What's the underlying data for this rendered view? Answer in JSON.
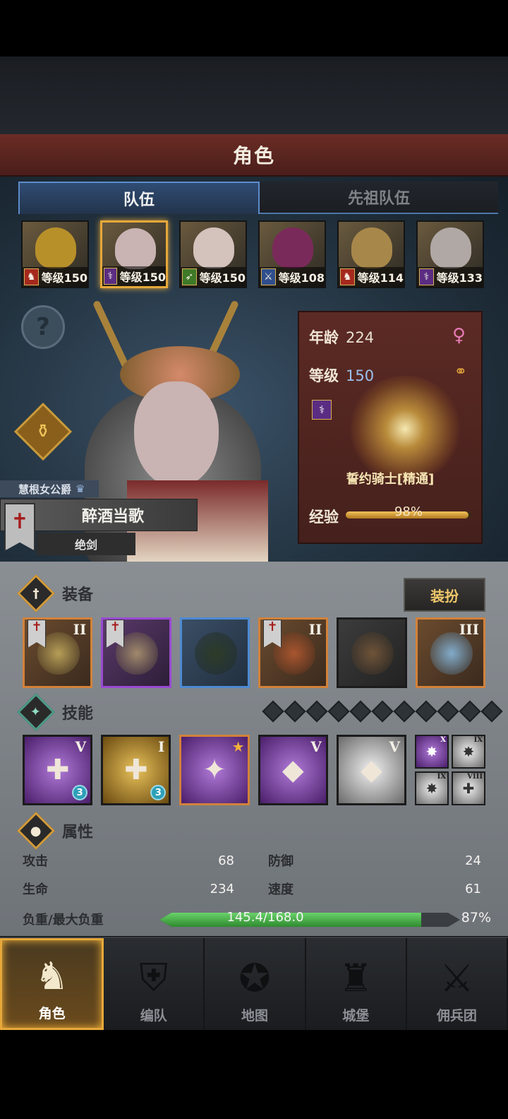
{
  "header": {
    "title": "角色"
  },
  "tabs": [
    {
      "label": "队伍",
      "active": true
    },
    {
      "label": "先祖队伍",
      "active": false
    }
  ],
  "party": [
    {
      "class_icon": "horse-icon",
      "class_color": "red",
      "level_text": "等级150",
      "selected": false,
      "face_color": "#b8902a"
    },
    {
      "class_icon": "staff-icon",
      "class_color": "purple",
      "level_text": "等级150",
      "selected": true,
      "face_color": "#c9b3b3"
    },
    {
      "class_icon": "bow-icon",
      "class_color": "green",
      "level_text": "等级150",
      "selected": false,
      "face_color": "#d4c2bc"
    },
    {
      "class_icon": "sword-icon",
      "class_color": "blue",
      "level_text": "等级108",
      "selected": false,
      "face_color": "#7a2a5a"
    },
    {
      "class_icon": "horse-icon",
      "class_color": "red",
      "level_text": "等级114",
      "selected": false,
      "face_color": "#a8884a"
    },
    {
      "class_icon": "staff-icon",
      "class_color": "purple",
      "level_text": "等级133",
      "selected": false,
      "face_color": "#b0a8a4"
    }
  ],
  "hero": {
    "title": "慧根女公爵",
    "name": "醉酒当歌",
    "subtitle": "绝剑"
  },
  "info": {
    "age_label": "年龄",
    "age_value": "224",
    "level_label": "等级",
    "level_value": "150",
    "class_name": "誓约骑士[精通]",
    "exp_label": "经验",
    "exp_text": "98%",
    "exp_fraction": 0.98,
    "gender_icon": "female-icon",
    "ring_icon": "ring-icon"
  },
  "equipment": {
    "title": "装备",
    "dress_button": "装扮",
    "slots": [
      {
        "name": "sword",
        "border": "orange",
        "tier": "II",
        "flag": true,
        "art": "#c8b060"
      },
      {
        "name": "shield",
        "border": "purple",
        "tier": "",
        "flag": true,
        "art": "#b09a70"
      },
      {
        "name": "hood",
        "border": "blue",
        "tier": "",
        "flag": false,
        "art": "#2d3a20"
      },
      {
        "name": "armor",
        "border": "orange",
        "tier": "II",
        "flag": true,
        "art": "#b85a30"
      },
      {
        "name": "boots",
        "border": "gray",
        "tier": "",
        "flag": false,
        "art": "#7a5a3a"
      },
      {
        "name": "amulet",
        "border": "orange",
        "tier": "III",
        "flag": false,
        "art": "#8ac0e8"
      }
    ]
  },
  "skills": {
    "title": "技能",
    "pip_count": 11,
    "items": [
      {
        "style": "purple",
        "rank": "V",
        "badge": "3",
        "glyph": "✚"
      },
      {
        "style": "gold",
        "rank": "I",
        "badge": "3",
        "glyph": "✚"
      },
      {
        "style": "orange-border",
        "rank": "",
        "badge": "",
        "star": true,
        "glyph": "✦"
      },
      {
        "style": "purple",
        "rank": "V",
        "badge": "",
        "glyph": "◆"
      },
      {
        "style": "silver",
        "rank": "V",
        "badge": "",
        "glyph": "◆"
      }
    ],
    "mini": [
      {
        "style": "purple",
        "rank": "X",
        "glyph": "✸"
      },
      {
        "style": "silver",
        "rank": "IX",
        "glyph": "✸"
      },
      {
        "style": "silver",
        "rank": "IX",
        "glyph": "✸"
      },
      {
        "style": "silver",
        "rank": "VIII",
        "glyph": "✚"
      }
    ]
  },
  "attributes": {
    "title": "属性",
    "attack_label": "攻击",
    "attack_value": "68",
    "defense_label": "防御",
    "defense_value": "24",
    "hp_label": "生命",
    "hp_value": "234",
    "speed_label": "速度",
    "speed_value": "61",
    "load_label": "负重/最大负重",
    "load_text": "145.4/168.0",
    "load_pct": "87%",
    "load_fraction": 0.87
  },
  "nav": [
    {
      "label": "角色",
      "icon": "knight-icon",
      "active": true,
      "glyph": "♞"
    },
    {
      "label": "编队",
      "icon": "helmet-icon",
      "active": false,
      "glyph": "⛨"
    },
    {
      "label": "地图",
      "icon": "compass-map-icon",
      "active": false,
      "glyph": "✪"
    },
    {
      "label": "城堡",
      "icon": "castle-icon",
      "active": false,
      "glyph": "♜"
    },
    {
      "label": "佣兵团",
      "icon": "mercenary-icon",
      "active": false,
      "glyph": "⚔"
    }
  ]
}
